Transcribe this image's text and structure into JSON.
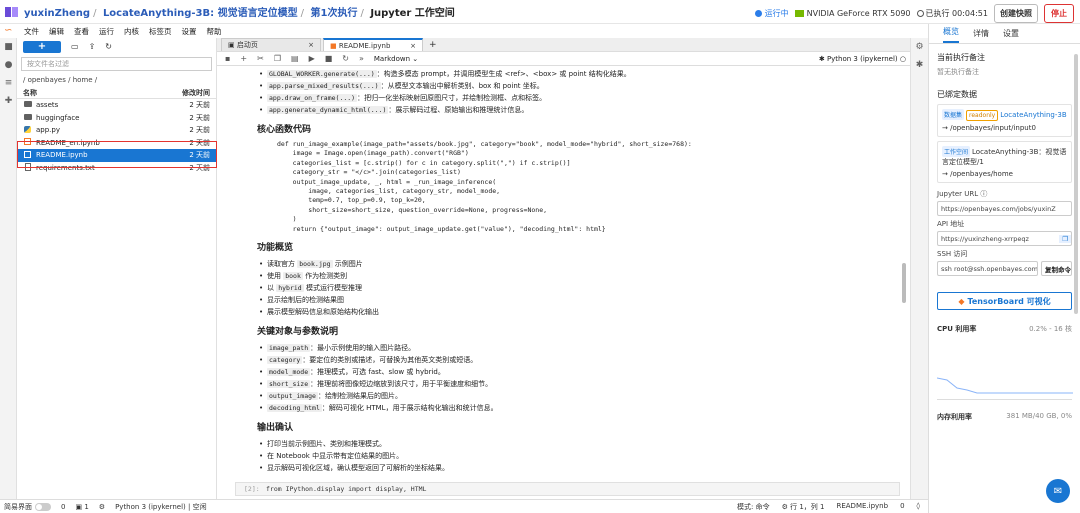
{
  "topbar": {
    "user": "yuxinZheng",
    "project": "LocateAnything-3B: 视觉语言定位模型",
    "run": "第1次执行",
    "workspace": "Jupyter 工作空间",
    "status": "运行中",
    "gpu": "NVIDIA GeForce RTX 5090",
    "elapsed": "已执行 00:04:51",
    "snapshot_label": "创建快照",
    "stop_label": "停止"
  },
  "menu": [
    "文件",
    "编辑",
    "查看",
    "运行",
    "内核",
    "标签页",
    "设置",
    "帮助"
  ],
  "filebrowser": {
    "filter_placeholder": "按文件名过滤",
    "path": "/ openbayes / home /",
    "col_name": "名称",
    "col_modified": "修改时间",
    "files": [
      {
        "name": "assets",
        "modified": "2 天前",
        "type": "folder"
      },
      {
        "name": "huggingface",
        "modified": "2 天前",
        "type": "folder"
      },
      {
        "name": "app.py",
        "modified": "2 天前",
        "type": "py"
      },
      {
        "name": "README_en.ipynb",
        "modified": "2 天前",
        "type": "nb"
      },
      {
        "name": "README.ipynb",
        "modified": "2 天前",
        "type": "nb",
        "selected": true
      },
      {
        "name": "requirements.txt",
        "modified": "2 天前",
        "type": "txt"
      }
    ]
  },
  "tabs": [
    {
      "label": "启动页"
    },
    {
      "label": "README.ipynb"
    }
  ],
  "nb_toolbar": {
    "cell_type": "Markdown",
    "kernel": "Python 3 (ipykernel)"
  },
  "notebook": {
    "top_list": [
      {
        "code": "GLOBAL_WORKER.generate(...)",
        "text": "：构造多模态 prompt，并调用模型生成 <ref>、<box> 或 point 结构化结果。"
      },
      {
        "code": "app.parse_mixed_results(...)",
        "text": "：从模型文本输出中解析类别、box 和 point 坐标。"
      },
      {
        "code": "app.draw_on_frame(...)",
        "text": "：把归一化坐标映射回原图尺寸，并绘制检测框、点和标签。"
      },
      {
        "code": "app.generate_dynamic_html(...)",
        "text": "：展示解码过程、原始输出和推理统计信息。"
      }
    ],
    "h_core": "核心函数代码",
    "code_lines": [
      "def run_image_example(image_path=\"assets/book.jpg\", category=\"book\", model_mode=\"hybrid\", short_size=768):",
      "    image = Image.open(image_path).convert(\"RGB\")",
      "    categories_list = [c.strip() for c in category.split(\",\") if c.strip()]",
      "    category_str = \"</c>\".join(categories_list)",
      "    output_image_update, _, html = _run_image_inference(",
      "        image, categories_list, category_str, model_mode,",
      "        temp=0.7, top_p=0.9, top_k=20,",
      "        short_size=short_size, question_override=None, progress=None,",
      "    )",
      "    return {\"output_image\": output_image_update.get(\"value\"), \"decoding_html\": html}"
    ],
    "h_overview": "功能概览",
    "overview": [
      {
        "pre": "读取官方 ",
        "code": "book.jpg",
        "post": " 示例图片"
      },
      {
        "pre": "使用 ",
        "code": "book",
        "post": " 作为检测类别"
      },
      {
        "pre": "以 ",
        "code": "hybrid",
        "post": " 模式运行模型推理"
      },
      {
        "pre": "显示绘制后的检测结果图",
        "code": "",
        "post": ""
      },
      {
        "pre": "展示模型解码信息和原始结构化输出",
        "code": "",
        "post": ""
      }
    ],
    "h_params": "关键对象与参数说明",
    "params": [
      {
        "code": "image_path",
        "text": "：最小示例使用的输入图片路径。"
      },
      {
        "code": "category",
        "text": "：要定位的类别或描述，可替换为其他英文类别或短语。"
      },
      {
        "code": "model_mode",
        "text": "：推理模式，可选 fast、slow 或 hybrid。"
      },
      {
        "code": "short_size",
        "text": "：推理前将图像短边缩放到该尺寸，用于平衡速度和细节。"
      },
      {
        "code": "output_image",
        "text": "：绘制检测结果后的图片。"
      },
      {
        "code": "decoding_html",
        "text": "：解码可视化 HTML，用于展示结构化输出和统计信息。"
      }
    ],
    "h_output": "输出确认",
    "output": [
      "打印当前示例图片、类别和推理模式。",
      "在 Notebook 中显示带有定位结果的图片。",
      "显示解码可视化区域，确认模型返回了可解析的坐标结果。"
    ],
    "in_prompt": "[2]:",
    "in_code": "from IPython.display import display, HTML"
  },
  "rightpanel": {
    "tabs": [
      "概览",
      "详情",
      "设置"
    ],
    "note_label": "当前执行备注",
    "note_value": "暂无执行备注",
    "bound_label": "已绑定数据",
    "data_badge": "数据集",
    "ro_badge": "readonly",
    "data_name": "LocateAnything-3B",
    "data_path": "→ /openbayes/input/input0",
    "ws_badge": "工作空间",
    "ws_name": "LocateAnything-3B：视觉语言定位模型/1",
    "ws_path": "→ /openbayes/home",
    "jupyter_label": "Jupyter URL ⓘ",
    "jupyter_url": "https://openbayes.com/jobs/yuxinZ",
    "api_label": "API 地址",
    "api_url": "https://yuxinzheng-xrrpeqz",
    "ssh_label": "SSH 访问",
    "ssh_cmd": "ssh root@ssh.openbayes.com",
    "copy_label": "复制命令",
    "tb_label": "TensorBoard 可视化",
    "cpu_label": "CPU 利用率",
    "cpu_value": "0.2% - 16 核",
    "mem_label": "内存利用率",
    "mem_value": "381 MB/40 GB, 0%"
  },
  "statusbar": {
    "simple": "简易界面",
    "n1": "0",
    "n2": "1",
    "kernel": "Python 3 (ipykernel) | 空闲",
    "mode": "模式: 命令",
    "pos": "行 1，列 1",
    "file": "README.ipynb",
    "n3": "0"
  }
}
